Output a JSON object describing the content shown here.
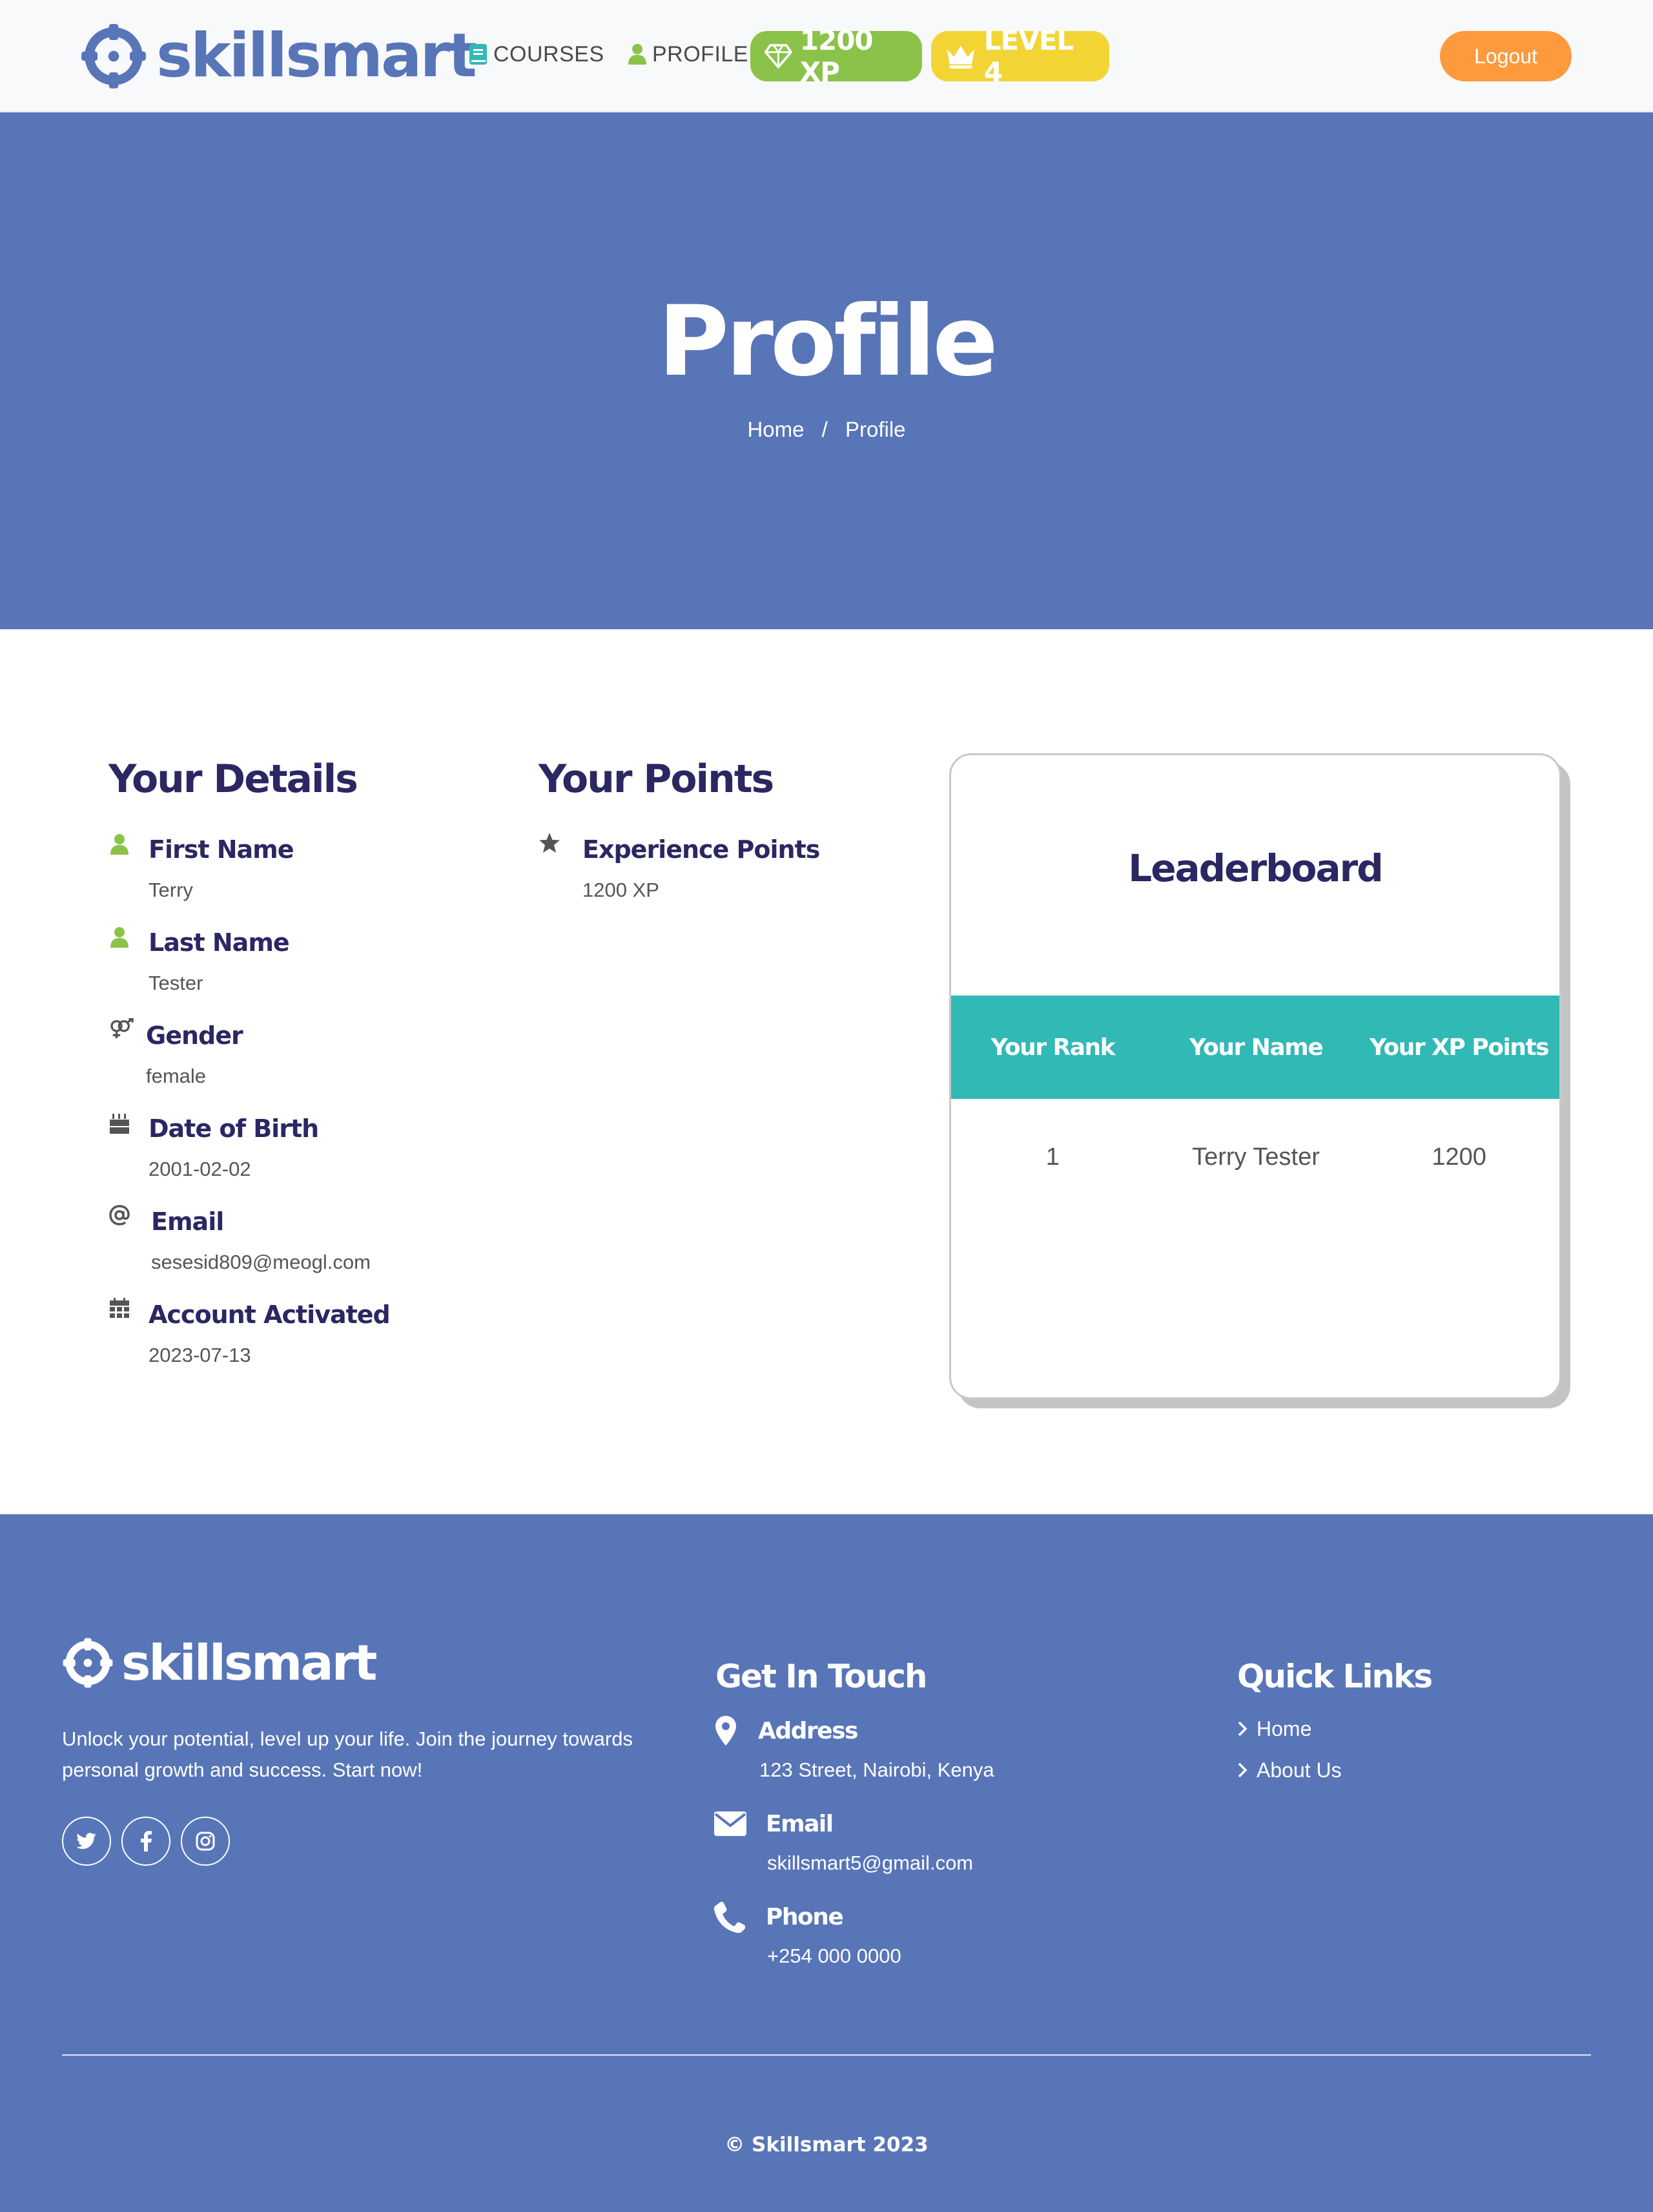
{
  "navbar": {
    "brand": "skillsmart",
    "links": [
      {
        "label": "COURSES",
        "icon": "book-icon"
      },
      {
        "label": "PROFILE",
        "icon": "user-icon"
      }
    ],
    "xp_badge": "1200 XP",
    "level_badge": "LEVEL 4",
    "logout_label": "Logout"
  },
  "hero": {
    "title": "Profile",
    "breadcrumb": {
      "home": "Home",
      "separator": "/",
      "current": "Profile"
    }
  },
  "details": {
    "title": "Your Details",
    "items": [
      {
        "label": "First Name",
        "value": "Terry",
        "icon": "user-icon"
      },
      {
        "label": "Last Name",
        "value": "Tester",
        "icon": "user-icon"
      },
      {
        "label": "Gender",
        "value": "female",
        "icon": "venus-mars-icon"
      },
      {
        "label": "Date of Birth",
        "value": "2001-02-02",
        "icon": "birthday-cake-icon"
      },
      {
        "label": "Email",
        "value": "sesesid809@meogl.com",
        "icon": "at-icon"
      },
      {
        "label": "Account Activated",
        "value": "2023-07-13",
        "icon": "calendar-icon"
      }
    ]
  },
  "points": {
    "title": "Your Points",
    "items": [
      {
        "label": "Experience Points",
        "value": "1200 XP",
        "icon": "star-icon"
      }
    ]
  },
  "leaderboard": {
    "title": "Leaderboard",
    "columns": [
      "Your Rank",
      "Your Name",
      "Your XP Points"
    ],
    "rows": [
      {
        "rank": "1",
        "name": "Terry Tester",
        "xp": "1200"
      }
    ]
  },
  "footer": {
    "brand": "skillsmart",
    "tagline": "Unlock your potential, level up your life. Join the journey towards personal growth and success. Start now!",
    "social": [
      "twitter-icon",
      "facebook-icon",
      "instagram-icon"
    ],
    "contact": {
      "title": "Get In Touch",
      "address_label": "Address",
      "address": "123 Street, Nairobi, Kenya",
      "email_label": "Email",
      "email": "skillsmart5@gmail.com",
      "phone_label": "Phone",
      "phone": "+254 000 0000"
    },
    "quick_links": {
      "title": "Quick Links",
      "items": [
        "Home",
        "About Us"
      ]
    },
    "copyright": "© Skillsmart 2023"
  },
  "colors": {
    "primary": "#5875b8",
    "navy": "#2b2763",
    "teal": "#31b9b6",
    "green": "#8bc34a",
    "yellow": "#f2d535",
    "orange": "#fd9a3e"
  }
}
